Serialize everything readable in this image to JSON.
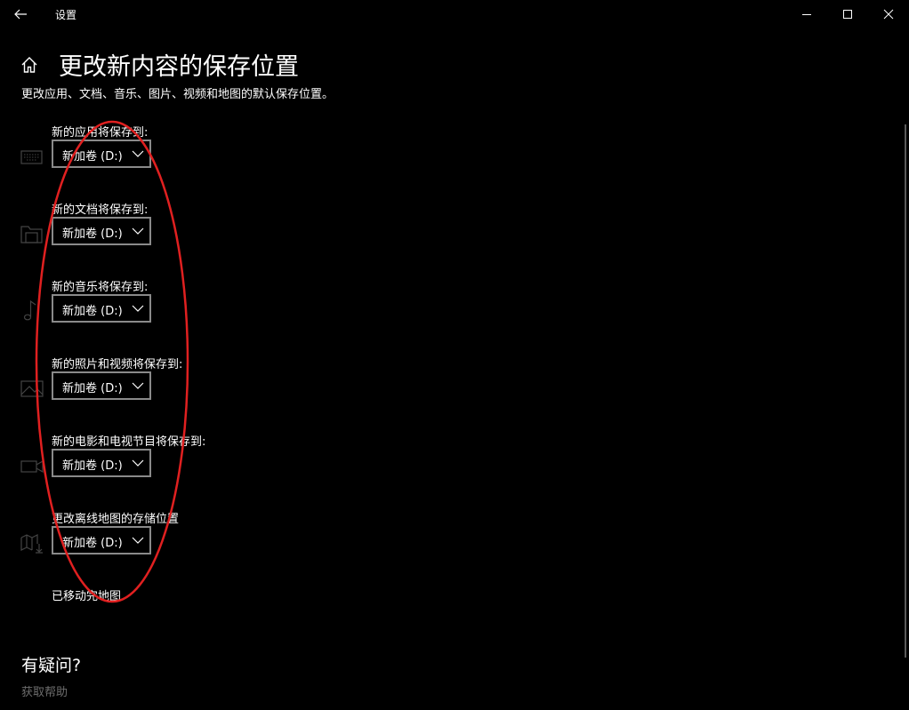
{
  "window": {
    "title": "设置",
    "controls": [
      "minimize-icon",
      "maximize-icon",
      "close-icon"
    ]
  },
  "page": {
    "title": "更改新内容的保存位置",
    "subtitle": "更改应用、文档、音乐、图片、视频和地图的默认保存位置。"
  },
  "settings": [
    {
      "label": "新的应用将保存到:",
      "value": "新加卷 (D:)",
      "icon": "monitor-keyboard-icon"
    },
    {
      "label": "新的文档将保存到:",
      "value": "新加卷 (D:)",
      "icon": "documents-folder-icon"
    },
    {
      "label": "新的音乐将保存到:",
      "value": "新加卷 (D:)",
      "icon": "music-note-icon"
    },
    {
      "label": "新的照片和视频将保存到:",
      "value": "新加卷 (D:)",
      "icon": "picture-icon"
    },
    {
      "label": "新的电影和电视节目将保存到:",
      "value": "新加卷 (D:)",
      "icon": "video-camera-icon"
    },
    {
      "label": "更改离线地图的存储位置",
      "value": "新加卷 (D:)",
      "icon": "map-download-icon"
    }
  ],
  "maps_status": "已移动完地图",
  "help": {
    "heading": "有疑问?",
    "link": "获取帮助"
  },
  "colors": {
    "background": "#000000",
    "text": "#ffffff",
    "dropdown_border": "#8a8a8a",
    "muted_link": "#6d6d6d",
    "annotation": "#e02020"
  }
}
